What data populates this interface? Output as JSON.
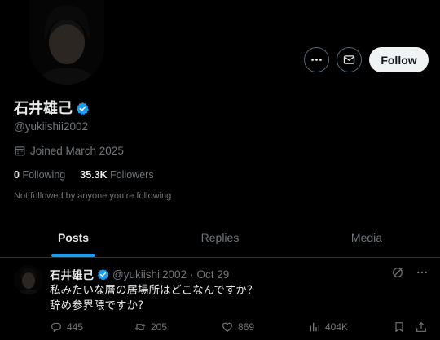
{
  "profile": {
    "display_name": "石井雄己",
    "handle": "@yukiishii2002",
    "joined": "Joined March 2025",
    "following_count": "0",
    "following_label": "Following",
    "followers_count": "35.3K",
    "followers_label": "Followers",
    "not_followed_note": "Not followed by anyone you’re following",
    "verified": true
  },
  "actions": {
    "more_icon": "more-horizontal-icon",
    "message_icon": "envelope-icon",
    "follow_label": "Follow"
  },
  "tabs": [
    {
      "label": "Posts",
      "active": true
    },
    {
      "label": "Replies",
      "active": false
    },
    {
      "label": "Media",
      "active": false
    }
  ],
  "tweet": {
    "name": "石井雄己",
    "handle": "@yukiishii2002",
    "separator": "·",
    "date": "Oct 29",
    "text_lines": [
      "私みたいな層の居場所はどこなんですか？",
      "辞め参界隈ですか？"
    ],
    "replies": "445",
    "reposts": "205",
    "likes": "869",
    "views": "404K"
  },
  "colors": {
    "background": "#000000",
    "text_primary": "#e7e9ea",
    "text_secondary": "#71767b",
    "accent": "#1d9bf0",
    "follow_button_bg": "#eff3f4",
    "border": "#2f3336"
  }
}
